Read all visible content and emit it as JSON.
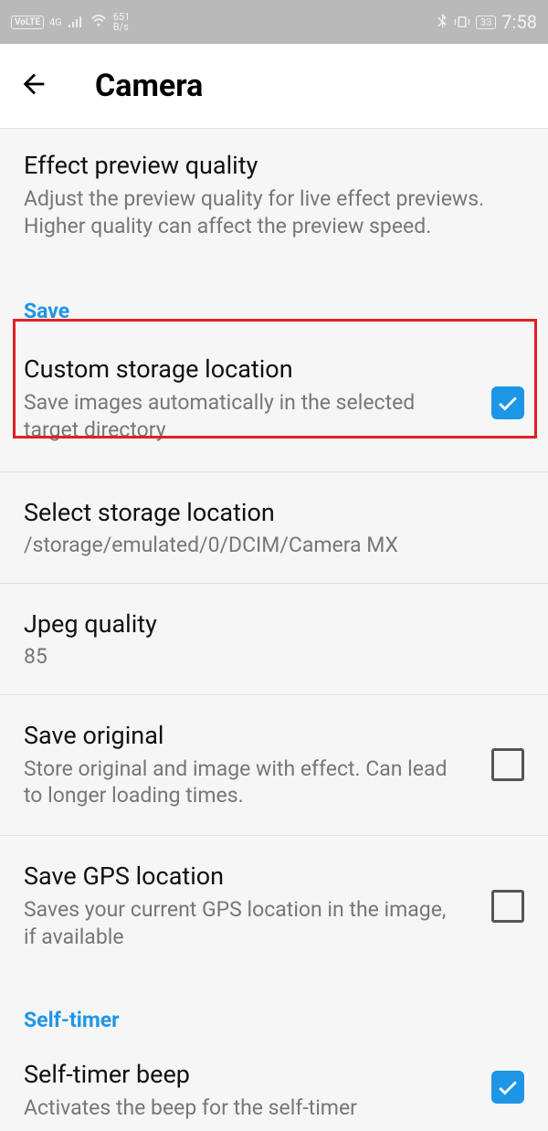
{
  "statusBar": {
    "volte": "VoLTE",
    "signal4g": "4G",
    "speed_top": "651",
    "speed_bottom": "B/s",
    "battery": "33",
    "time": "7:58"
  },
  "header": {
    "title": "Camera"
  },
  "sections": {
    "effect": {
      "title": "Effect preview quality",
      "desc": "Adjust the preview quality for live effect previews. Higher quality can affect the preview speed."
    },
    "saveHeader": "Save",
    "customStorage": {
      "title": "Custom storage location",
      "desc": "Save images automatically in the selected target directory",
      "checked": true
    },
    "selectStorage": {
      "title": "Select storage location",
      "value": "/storage/emulated/0/DCIM/Camera MX"
    },
    "jpeg": {
      "title": "Jpeg quality",
      "value": "85"
    },
    "saveOriginal": {
      "title": "Save original",
      "desc": "Store original and image with effect. Can lead to longer loading times.",
      "checked": false
    },
    "gps": {
      "title": "Save GPS location",
      "desc": "Saves your current GPS location in the image, if available",
      "checked": false
    },
    "selfTimerHeader": "Self-timer",
    "selfTimerBeep": {
      "title": "Self-timer beep",
      "desc": "Activates the beep for the self-timer",
      "checked": true
    }
  }
}
